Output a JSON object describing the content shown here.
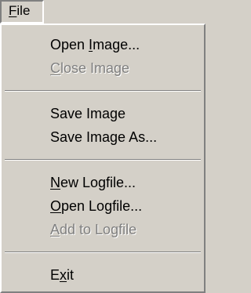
{
  "menubar": {
    "file_menu": {
      "mnemonic": "F",
      "rest": "ile"
    }
  },
  "menu": {
    "open_image": {
      "before": "Open ",
      "mnemonic": "I",
      "after": "mage..."
    },
    "close_image": {
      "before": "",
      "mnemonic": "C",
      "after": "lose Image"
    },
    "save_image": "Save Image",
    "save_image_as": "Save Image As...",
    "new_logfile": {
      "before": "",
      "mnemonic": "N",
      "after": "ew Logfile..."
    },
    "open_logfile": {
      "before": "",
      "mnemonic": "O",
      "after": "pen Logfile..."
    },
    "add_to_logfile": {
      "before": "",
      "mnemonic": "A",
      "after": "dd to Logfile"
    },
    "exit": {
      "before": "E",
      "mnemonic": "x",
      "after": "it"
    }
  },
  "colors": {
    "face": "#d4d0c8",
    "shadow": "#808080",
    "highlight": "#ffffff",
    "disabled_text": "#808080"
  }
}
